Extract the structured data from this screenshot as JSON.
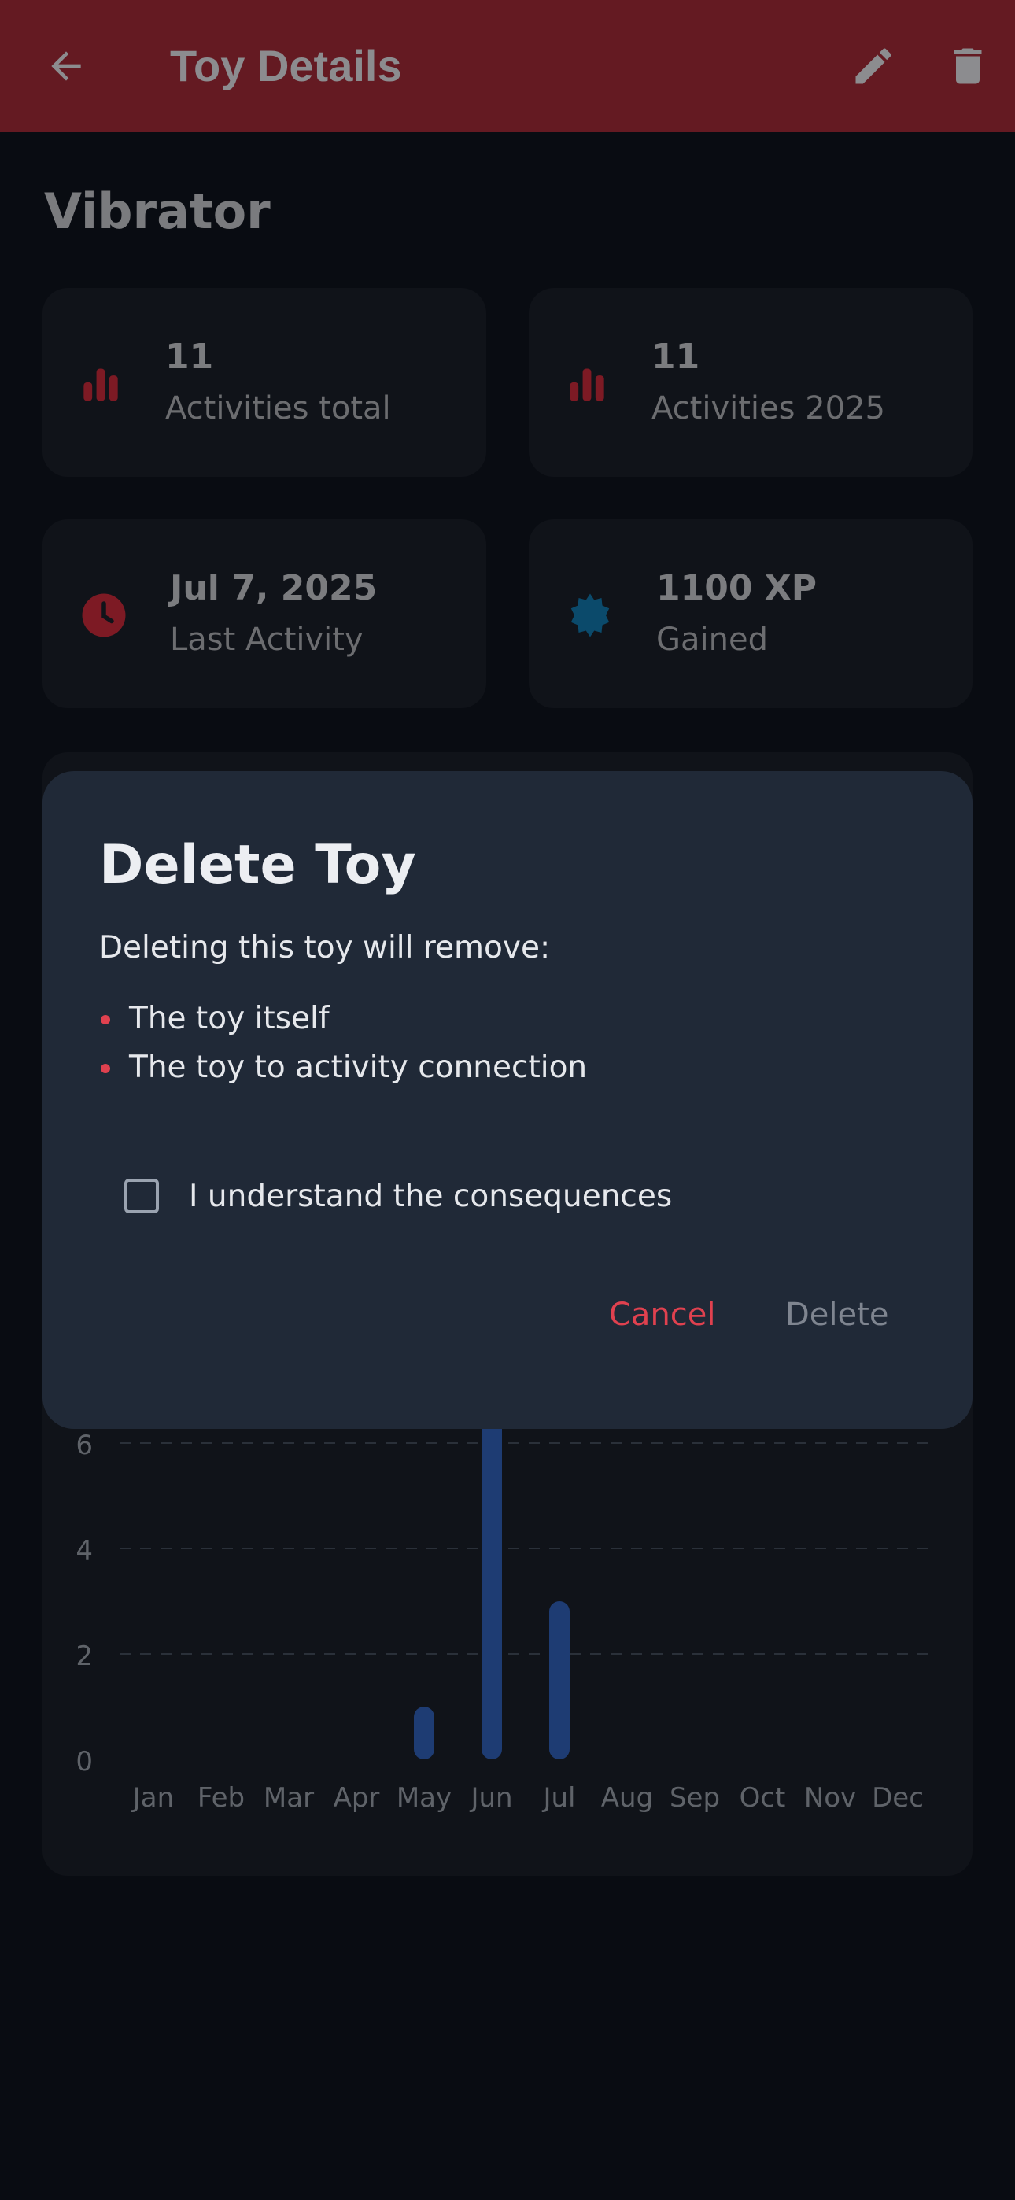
{
  "appbar": {
    "title": "Toy Details",
    "back_icon": "arrow-left-icon",
    "edit_icon": "pencil-icon",
    "delete_icon": "trash-icon",
    "color": "#641a22"
  },
  "toy": {
    "name": "Vibrator"
  },
  "stats": [
    {
      "icon": "bar-chart-icon",
      "value": "11",
      "label": "Activities total",
      "icon_color": "#7d1a24"
    },
    {
      "icon": "bar-chart-icon",
      "value": "11",
      "label": "Activities 2025",
      "icon_color": "#7d1a24"
    },
    {
      "icon": "clock-icon",
      "value": "Jul 7, 2025",
      "label": "Last Activity",
      "icon_color": "#7d1a24"
    },
    {
      "icon": "badge-icon",
      "value": "1100 XP",
      "label": "Gained",
      "icon_color": "#0b4a6b"
    }
  ],
  "dialog": {
    "title": "Delete Toy",
    "intro": "Deleting this toy will remove:",
    "items": [
      "The toy itself",
      "The toy to activity connection"
    ],
    "checkbox_label": "I understand the consequences",
    "checkbox_checked": false,
    "cancel_label": "Cancel",
    "delete_label": "Delete",
    "accent": "#e0414f"
  },
  "chart_data": {
    "type": "bar",
    "categories": [
      "Jan",
      "Feb",
      "Mar",
      "Apr",
      "May",
      "Jun",
      "Jul",
      "Aug",
      "Sep",
      "Oct",
      "Nov",
      "Dec"
    ],
    "values": [
      0,
      0,
      0,
      0,
      1,
      7,
      3,
      0,
      0,
      0,
      0,
      0
    ],
    "y_ticks": [
      "0",
      "2",
      "4",
      "6"
    ],
    "ylim": [
      0,
      8
    ],
    "grid": true,
    "bar_color": "#1e3c73"
  }
}
